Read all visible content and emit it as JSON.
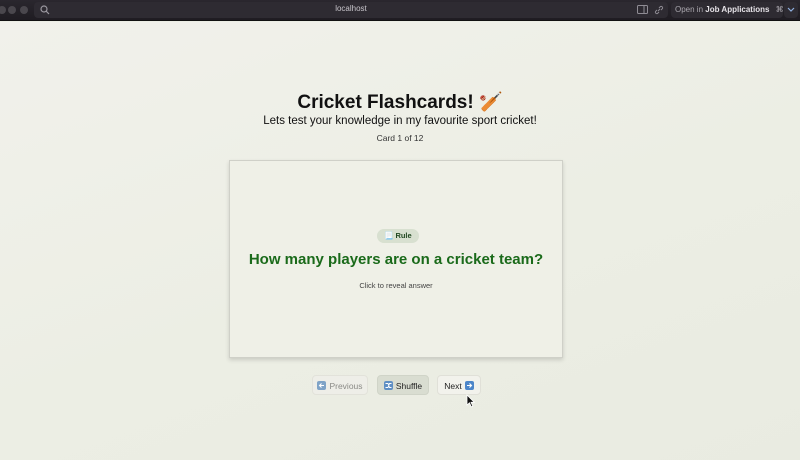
{
  "browser": {
    "url": "localhost",
    "open_in_prefix": "Open in",
    "open_in_app": "Job Applications",
    "shortcut": "⌘O"
  },
  "app": {
    "title": "Cricket Flashcards! 🏏",
    "subtitle": "Lets test your knowledge in my favourite sport cricket!",
    "counter": "Card 1 of 12"
  },
  "card": {
    "category_icon": "📃",
    "category": "Rule",
    "question": "How many players are on a cricket team?",
    "hint": "Click to reveal answer"
  },
  "controls": {
    "previous_label": "Previous",
    "shuffle_label": "Shuffle",
    "next_label": "Next"
  },
  "colors": {
    "question": "#1a6a1a",
    "badge_bg": "#d8e0d0",
    "page_bg": "#eceee5"
  }
}
